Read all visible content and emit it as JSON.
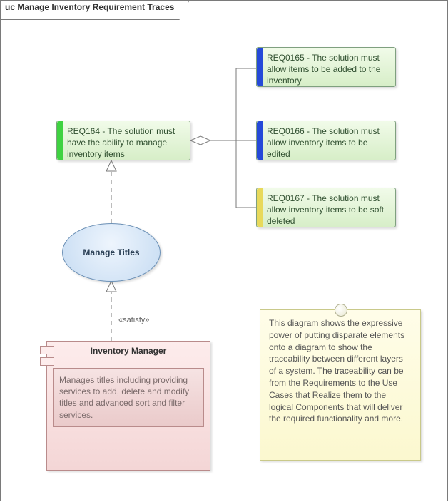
{
  "frame": {
    "title": "uc Manage Inventory Requirement Traces"
  },
  "req164": {
    "text": "REQ164 - The solution must have the ability to manage inventory items",
    "barColor": "#3fd241"
  },
  "req0165": {
    "text": "REQ0165 - The solution must allow items to be added to the inventory",
    "barColor": "#2549d8"
  },
  "req0166": {
    "text": "REQ0166 - The solution must allow inventory items to be edited",
    "barColor": "#2549d8"
  },
  "req0167": {
    "text": "REQ0167 - The solution must allow inventory items to be soft deleted",
    "barColor": "#e8d95b"
  },
  "usecase": {
    "name": "Manage Titles"
  },
  "stereotype": {
    "satisfy": "«satisfy»"
  },
  "component": {
    "name": "Inventory Manager",
    "description": "Manages titles including providing services to add, delete and modify titles and advanced sort and filter services."
  },
  "note": {
    "text": "This diagram shows the expressive power of putting disparate elements onto a diagram to show the traceability between different layers of a system. The traceability can be  from the Requirements to the Use Cases that Realize them to the logical Components that will deliver the required functionality and more."
  }
}
